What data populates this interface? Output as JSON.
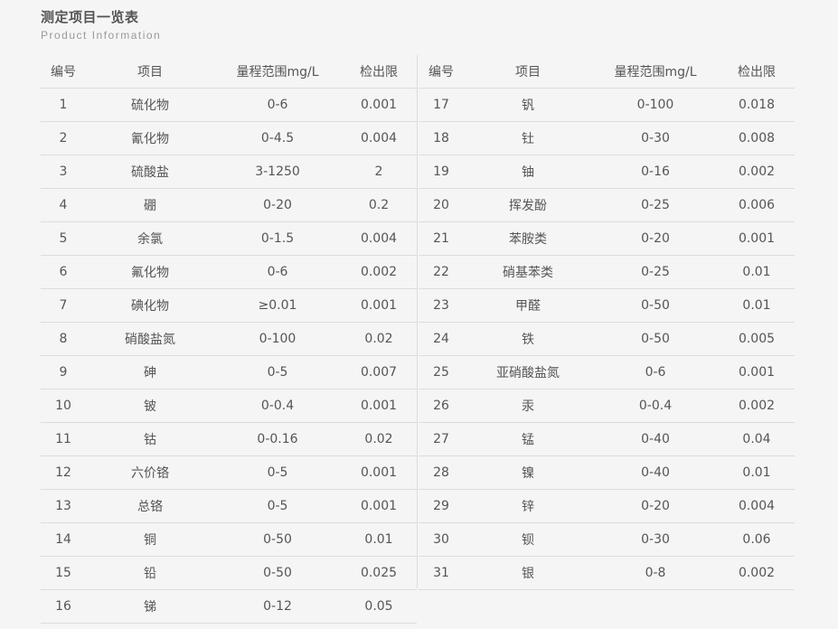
{
  "header": {
    "title": "测定项目一览表",
    "subtitle": "Product Information"
  },
  "columns": [
    "编号",
    "项目",
    "量程范围mg/L",
    "检出限"
  ],
  "left_rows": [
    [
      "1",
      "硫化物",
      "0-6",
      "0.001"
    ],
    [
      "2",
      "氰化物",
      "0-4.5",
      "0.004"
    ],
    [
      "3",
      "硫酸盐",
      "3-1250",
      "2"
    ],
    [
      "4",
      "硼",
      "0-20",
      "0.2"
    ],
    [
      "5",
      "余氯",
      "0-1.5",
      "0.004"
    ],
    [
      "6",
      "氟化物",
      "0-6",
      "0.002"
    ],
    [
      "7",
      "碘化物",
      "≥0.01",
      "0.001"
    ],
    [
      "8",
      "硝酸盐氮",
      "0-100",
      "0.02"
    ],
    [
      "9",
      "砷",
      "0-5",
      "0.007"
    ],
    [
      "10",
      "铍",
      "0-0.4",
      "0.001"
    ],
    [
      "11",
      "钴",
      "0-0.16",
      "0.02"
    ],
    [
      "12",
      "六价铬",
      "0-5",
      "0.001"
    ],
    [
      "13",
      "总铬",
      "0-5",
      "0.001"
    ],
    [
      "14",
      "铜",
      "0-50",
      "0.01"
    ],
    [
      "15",
      "铅",
      "0-50",
      "0.025"
    ],
    [
      "16",
      "锑",
      "0-12",
      "0.05"
    ]
  ],
  "right_rows": [
    [
      "17",
      "钒",
      "0-100",
      "0.018"
    ],
    [
      "18",
      "钍",
      "0-30",
      "0.008"
    ],
    [
      "19",
      "铀",
      "0-16",
      "0.002"
    ],
    [
      "20",
      "挥发酚",
      "0-25",
      "0.006"
    ],
    [
      "21",
      "苯胺类",
      "0-20",
      "0.001"
    ],
    [
      "22",
      "硝基苯类",
      "0-25",
      "0.01"
    ],
    [
      "23",
      "甲醛",
      "0-50",
      "0.01"
    ],
    [
      "24",
      "铁",
      "0-50",
      "0.005"
    ],
    [
      "25",
      "亚硝酸盐氮",
      "0-6",
      "0.001"
    ],
    [
      "26",
      "汞",
      "0-0.4",
      "0.002"
    ],
    [
      "27",
      "锰",
      "0-40",
      "0.04"
    ],
    [
      "28",
      "镍",
      "0-40",
      "0.01"
    ],
    [
      "29",
      "锌",
      "0-20",
      "0.004"
    ],
    [
      "30",
      "钡",
      "0-30",
      "0.06"
    ],
    [
      "31",
      "银",
      "0-8",
      "0.002"
    ]
  ]
}
